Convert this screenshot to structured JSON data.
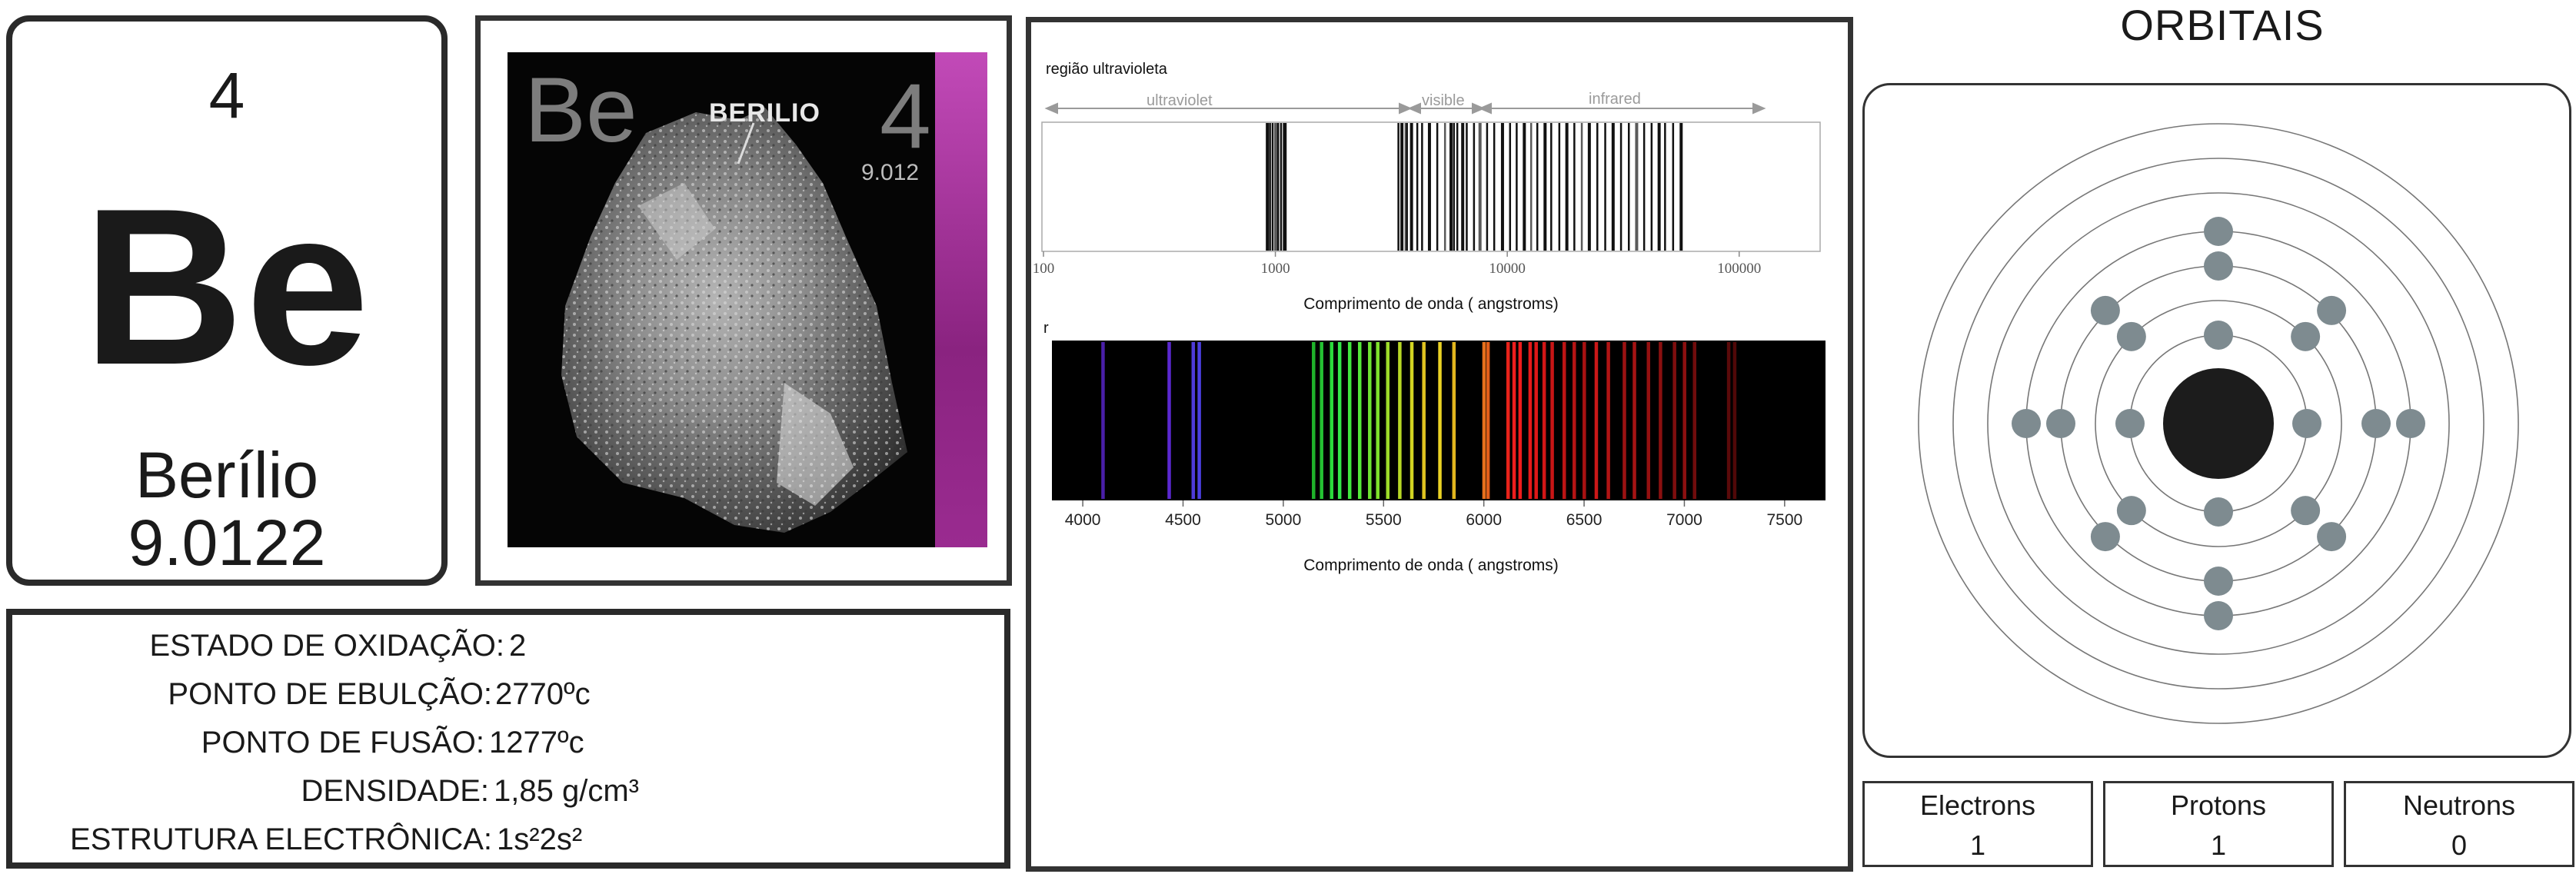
{
  "element": {
    "atomic_number": "4",
    "symbol": "Be",
    "name": "Berílio",
    "atomic_mass": "9.0122"
  },
  "photo": {
    "symbol": "Be",
    "number": "4",
    "mass": "9.012",
    "label": "BERILIO"
  },
  "properties": [
    {
      "label": "ESTADO DE OXIDAÇÃO:",
      "value": "2"
    },
    {
      "label": "PONTO DE EBULÇÃO:",
      "value": "2770ºc"
    },
    {
      "label": "PONTO DE FUSÃO:",
      "value": "1277ºc"
    },
    {
      "label": "DENSIDADE:",
      "value": "1,85 g/cm³"
    },
    {
      "label": "ESTRUTURA ELECTRÔNICA:",
      "value": "1s²2s²"
    }
  ],
  "spectrum": {
    "region_title": "região ultravioleta",
    "bands": [
      "ultraviolet",
      "visible",
      "infrared"
    ],
    "top_ticks": [
      "100",
      "1000",
      "10000",
      "100000"
    ],
    "top_xlabel": "Comprimento de onda ( angstroms)",
    "bottom_corner_label": "r",
    "bottom_ticks": [
      "4000",
      "4500",
      "5000",
      "5500",
      "6000",
      "6500",
      "7000",
      "7500"
    ],
    "bottom_xlabel": "Comprimento de onda ( angstroms)"
  },
  "chart_data": [
    {
      "type": "other",
      "description_scale": "log",
      "x": [
        920,
        950,
        975,
        1000,
        1030,
        1060,
        1090,
        1110,
        3400,
        3500,
        3650,
        3700,
        3850,
        4100,
        4300,
        4600,
        5000,
        5400,
        5700,
        5900,
        6100,
        6400,
        6700,
        7200,
        7600,
        8200,
        8800,
        9500,
        10300,
        11000,
        11800,
        12700,
        13500,
        14500,
        15500,
        16800,
        18000,
        19500,
        21000,
        22500,
        24500,
        26500,
        28500,
        31000,
        33500,
        36000,
        39000,
        42000,
        45000,
        48000,
        52000,
        56000
      ],
      "xlim": [
        100,
        220000
      ],
      "xscale": "log",
      "xlabel": "Comprimento de onda ( angstroms)",
      "tick_labels": [
        "100",
        "1000",
        "10000",
        "100000"
      ]
    },
    {
      "type": "other",
      "x": [
        4100,
        4430,
        4550,
        4580,
        5150,
        5190,
        5240,
        5280,
        5330,
        5380,
        5430,
        5470,
        5520,
        5580,
        5640,
        5700,
        5780,
        5850,
        6000,
        6020,
        6120,
        6150,
        6180,
        6230,
        6260,
        6300,
        6340,
        6400,
        6450,
        6500,
        6560,
        6620,
        6700,
        6750,
        6820,
        6880,
        6950,
        7000,
        7050,
        7220,
        7250
      ],
      "colors": [
        "#4a1fa8",
        "#5b28d0",
        "#4e3bd8",
        "#4b3fe0",
        "#1fb32a",
        "#24c233",
        "#2ad93c",
        "#33e64a",
        "#41e83f",
        "#55ea3a",
        "#6fe532",
        "#7fe22c",
        "#9ddc2a",
        "#b8d826",
        "#d2d422",
        "#e0c320",
        "#ead224",
        "#e2b61e",
        "#e6701c",
        "#e25e1a",
        "#e8221a",
        "#ee1e1e",
        "#f01c1c",
        "#e61a1a",
        "#dd1818",
        "#d21616",
        "#c81616",
        "#bc1414",
        "#b51414",
        "#a81212",
        "#cc1818",
        "#b01414",
        "#9c1212",
        "#a51414",
        "#941010",
        "#8a1010",
        "#7e0e0e",
        "#8c1010",
        "#700c0c",
        "#5a0a0a",
        "#500808"
      ],
      "xlim": [
        3850,
        7700
      ],
      "xlabel": "Comprimento de onda ( angstroms)",
      "tick_labels": [
        "4000",
        "4500",
        "5000",
        "5500",
        "6000",
        "6500",
        "7000",
        "7500"
      ]
    }
  ],
  "orbitals": {
    "title": "ORBITAIS",
    "shell_count": 7,
    "electrons_per_shell": [
      4,
      4,
      4,
      4
    ]
  },
  "particles": [
    {
      "title": "Electrons",
      "value": "1"
    },
    {
      "title": "Protons",
      "value": "1"
    },
    {
      "title": "Neutrons",
      "value": "0"
    }
  ]
}
